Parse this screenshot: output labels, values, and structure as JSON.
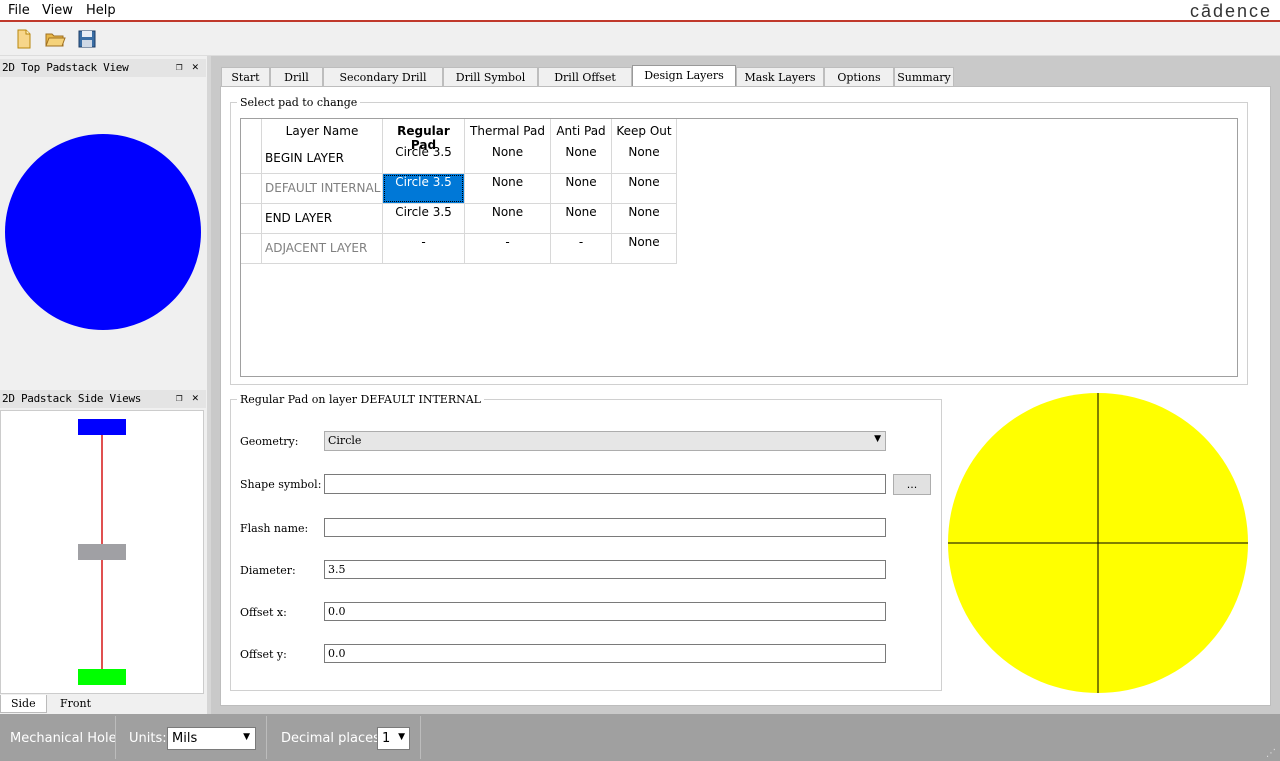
{
  "menu": {
    "file": "File",
    "view": "View",
    "help": "Help",
    "brand": "cādence"
  },
  "toolbar": {
    "new_icon": "new-file-icon",
    "open_icon": "open-folder-icon",
    "save_icon": "save-disk-icon"
  },
  "docks": {
    "top_view_title": "2D Top Padstack View",
    "side_view_title": "2D Padstack Side Views",
    "side_tab": "Side",
    "front_tab": "Front"
  },
  "tabs": [
    "Start",
    "Drill",
    "Secondary Drill",
    "Drill Symbol",
    "Drill Offset",
    "Design Layers",
    "Mask Layers",
    "Options",
    "Summary"
  ],
  "active_tab": "Design Layers",
  "select_pad": {
    "title": "Select pad to change",
    "columns": [
      "Layer Name",
      "Regular Pad",
      "Thermal Pad",
      "Anti Pad",
      "Keep Out"
    ],
    "rows": [
      {
        "layer": "BEGIN LAYER",
        "regular": "Circle 3.5",
        "thermal": "None",
        "anti": "None",
        "keepout": "None",
        "dim": false
      },
      {
        "layer": "DEFAULT INTERNAL",
        "regular": "Circle 3.5",
        "thermal": "None",
        "anti": "None",
        "keepout": "None",
        "dim": true,
        "selected": true
      },
      {
        "layer": "END LAYER",
        "regular": "Circle 3.5",
        "thermal": "None",
        "anti": "None",
        "keepout": "None",
        "dim": false
      },
      {
        "layer": "ADJACENT LAYER",
        "regular": "-",
        "thermal": "-",
        "anti": "-",
        "keepout": "None",
        "dim": true
      }
    ]
  },
  "pad_form": {
    "title": "Regular Pad on layer DEFAULT INTERNAL",
    "geometry_label": "Geometry:",
    "geometry_value": "Circle",
    "shape_symbol_label": "Shape symbol:",
    "shape_symbol_value": "",
    "browse_label": "...",
    "flash_name_label": "Flash name:",
    "flash_name_value": "",
    "diameter_label": "Diameter:",
    "diameter_value": "3.5",
    "offset_x_label": "Offset x:",
    "offset_x_value": "0.0",
    "offset_y_label": "Offset y:",
    "offset_y_value": "0.0"
  },
  "statusbar": {
    "mode": "Mechanical Hole",
    "units_label": "Units:",
    "units_value": "Mils",
    "decimal_label": "Decimal places:",
    "decimal_value": "1"
  },
  "colors": {
    "top_pad": "#0000ff",
    "preview_pad": "#ffff00",
    "side_top": "#0000ff",
    "side_mid": "#a0a0a4",
    "side_bottom": "#00ff00",
    "drill_line": "#e05050",
    "selection": "#0078d7"
  }
}
